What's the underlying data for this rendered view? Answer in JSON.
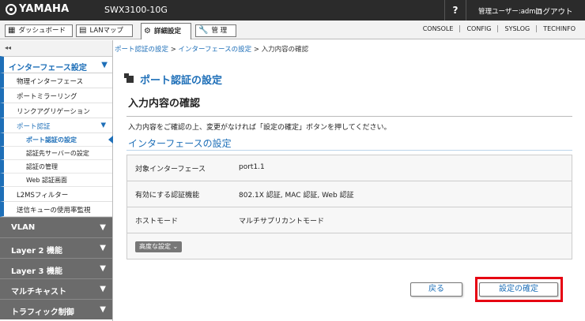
{
  "header": {
    "brand": "YAMAHA",
    "model": "SWX3100-10G",
    "help": "?",
    "user": "管理ユーザー:admin",
    "logout": "ログアウト"
  },
  "nav": {
    "dashboard": "ダッシュボード",
    "lanmap": "LANマップ",
    "advanced": "詳細設定",
    "manage": "管 理",
    "links": [
      "CONSOLE",
      "CONFIG",
      "SYSLOG",
      "TECHINFO"
    ]
  },
  "sidebar": {
    "collapse": "◂◂",
    "section": "インターフェース設定",
    "items": [
      "物理インターフェース",
      "ポートミラーリング",
      "リンクアグリゲーション"
    ],
    "port_auth": "ポート認証",
    "subitems": [
      "ポート認証の設定",
      "認証先サーバーの設定",
      "認証の管理",
      "Web 認証画面"
    ],
    "items2": [
      "L2MSフィルター",
      "送信キューの使用率監視"
    ],
    "groups": [
      "VLAN",
      "Layer 2 機能",
      "Layer 3 機能",
      "マルチキャスト",
      "トラフィック制御"
    ]
  },
  "breadcrumb": {
    "a": "ポート認証の設定",
    "sep": " > ",
    "b": "インターフェースの設定",
    "c": "入力内容の確認"
  },
  "main": {
    "page_title": "ポート認証の設定",
    "confirm_title": "入力内容の確認",
    "description": "入力内容をご確認の上、変更がなければ「設定の確定」ボタンを押してください。",
    "section_title": "インターフェースの設定",
    "rows": [
      {
        "key": "対象インターフェース",
        "value": "port1.1"
      },
      {
        "key": "有効にする認証機能",
        "value": "802.1X 認証, MAC 認証, Web 認証"
      },
      {
        "key": "ホストモード",
        "value": "マルチサプリカントモード"
      }
    ],
    "advanced": "高度な設定 ⌄",
    "back": "戻る",
    "confirm": "設定の確定"
  },
  "colors": {
    "accent": "#1e6fb8",
    "highlight": "#e60012",
    "topbar": "#2b2b2b"
  }
}
